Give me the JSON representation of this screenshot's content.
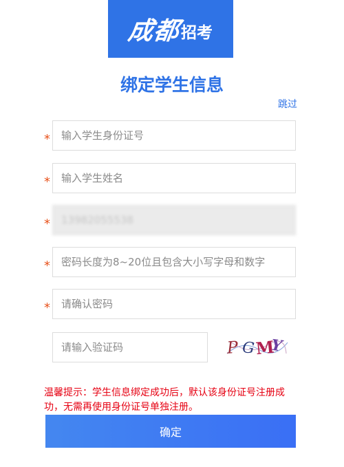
{
  "brand": {
    "logo_script": "成都",
    "logo_plain": "招考",
    "logo_color": "#2f73e6"
  },
  "page_title": "绑定学生信息",
  "skip_label": "跳过",
  "required_mark": "*",
  "form": {
    "id_card": {
      "value": "",
      "placeholder": "输入学生身份证号",
      "required": true
    },
    "student_name": {
      "value": "",
      "placeholder": "输入学生姓名",
      "required": true
    },
    "phone": {
      "value": "13982055538",
      "placeholder": "",
      "required": true,
      "disabled": true
    },
    "password": {
      "value": "",
      "placeholder": "密码长度为8~20位且包含大小写字母和数字",
      "required": true
    },
    "confirm_password": {
      "value": "",
      "placeholder": "请确认密码",
      "required": true
    },
    "captcha": {
      "value": "",
      "placeholder": "请输入验证码",
      "image_text": "PGMY"
    }
  },
  "notice": "温馨提示：学生信息绑定成功后，默认该身份证号注册成功，无需再使用身份证号单独注册。",
  "submit_label": "确定",
  "colors": {
    "primary": "#2f73e6",
    "required": "#e8531d",
    "notice": "#e60012"
  }
}
